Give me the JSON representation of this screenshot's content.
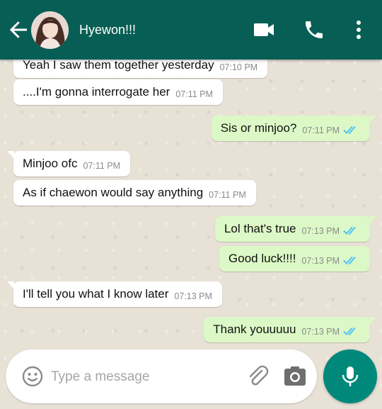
{
  "header": {
    "contact_name": "Hyewon!!!",
    "color": "#075e54"
  },
  "icons": {
    "back": "arrow-back-icon",
    "video": "video-call-icon",
    "call": "phone-icon",
    "menu": "more-vert-icon",
    "emoji": "emoji-icon",
    "attach": "paperclip-icon",
    "camera": "camera-icon",
    "mic": "mic-icon"
  },
  "colors": {
    "outgoing_bubble": "#dcf8c6",
    "incoming_bubble": "#ffffff",
    "read_ticks": "#4fc3f7",
    "fab": "#00897b"
  },
  "messages": [
    {
      "dir": "in",
      "text": "Yeah I saw them together yesterday",
      "time": "07:10 PM"
    },
    {
      "dir": "in",
      "text": "....I'm gonna interrogate her",
      "time": "07:11 PM"
    },
    {
      "dir": "out",
      "text": "Sis or minjoo?",
      "time": "07:11 PM",
      "status": "read"
    },
    {
      "dir": "in",
      "text": "Minjoo ofc",
      "time": "07:11 PM"
    },
    {
      "dir": "in",
      "text": "As if chaewon would say anything",
      "time": "07:11 PM"
    },
    {
      "dir": "out",
      "text": "Lol that's true",
      "time": "07:13 PM",
      "status": "read"
    },
    {
      "dir": "out",
      "text": "Good luck!!!!",
      "time": "07:13 PM",
      "status": "read"
    },
    {
      "dir": "in",
      "text": "I'll tell you what I know later",
      "time": "07:13 PM"
    },
    {
      "dir": "out",
      "text": "Thank youuuuu",
      "time": "07:13 PM",
      "status": "read"
    }
  ],
  "composer": {
    "placeholder": "Type a message",
    "value": ""
  }
}
